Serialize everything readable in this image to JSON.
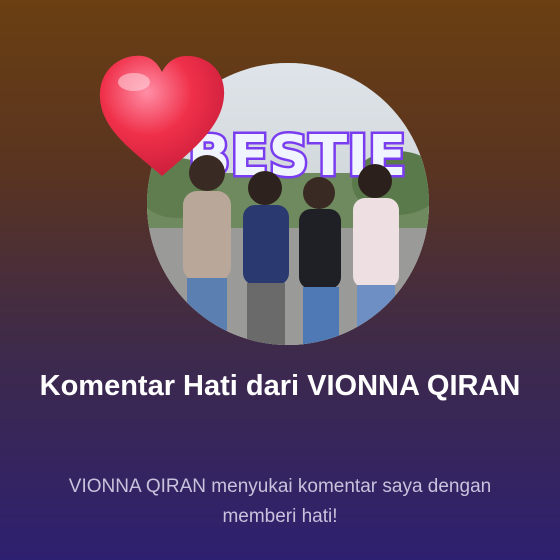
{
  "notification": {
    "title": "Komentar Hati dari VIONNA QIRAN",
    "message": "VIONNA QIRAN menyukai komentar saya dengan memberi hati!",
    "photo_text": "BESTIE",
    "heart_icon": "heart-icon",
    "colors": {
      "background_top": "#6a3f12",
      "background_bottom": "#2e2070",
      "title": "#ffffff",
      "message": "#c8c2dc",
      "heart": "#f0304a"
    }
  }
}
